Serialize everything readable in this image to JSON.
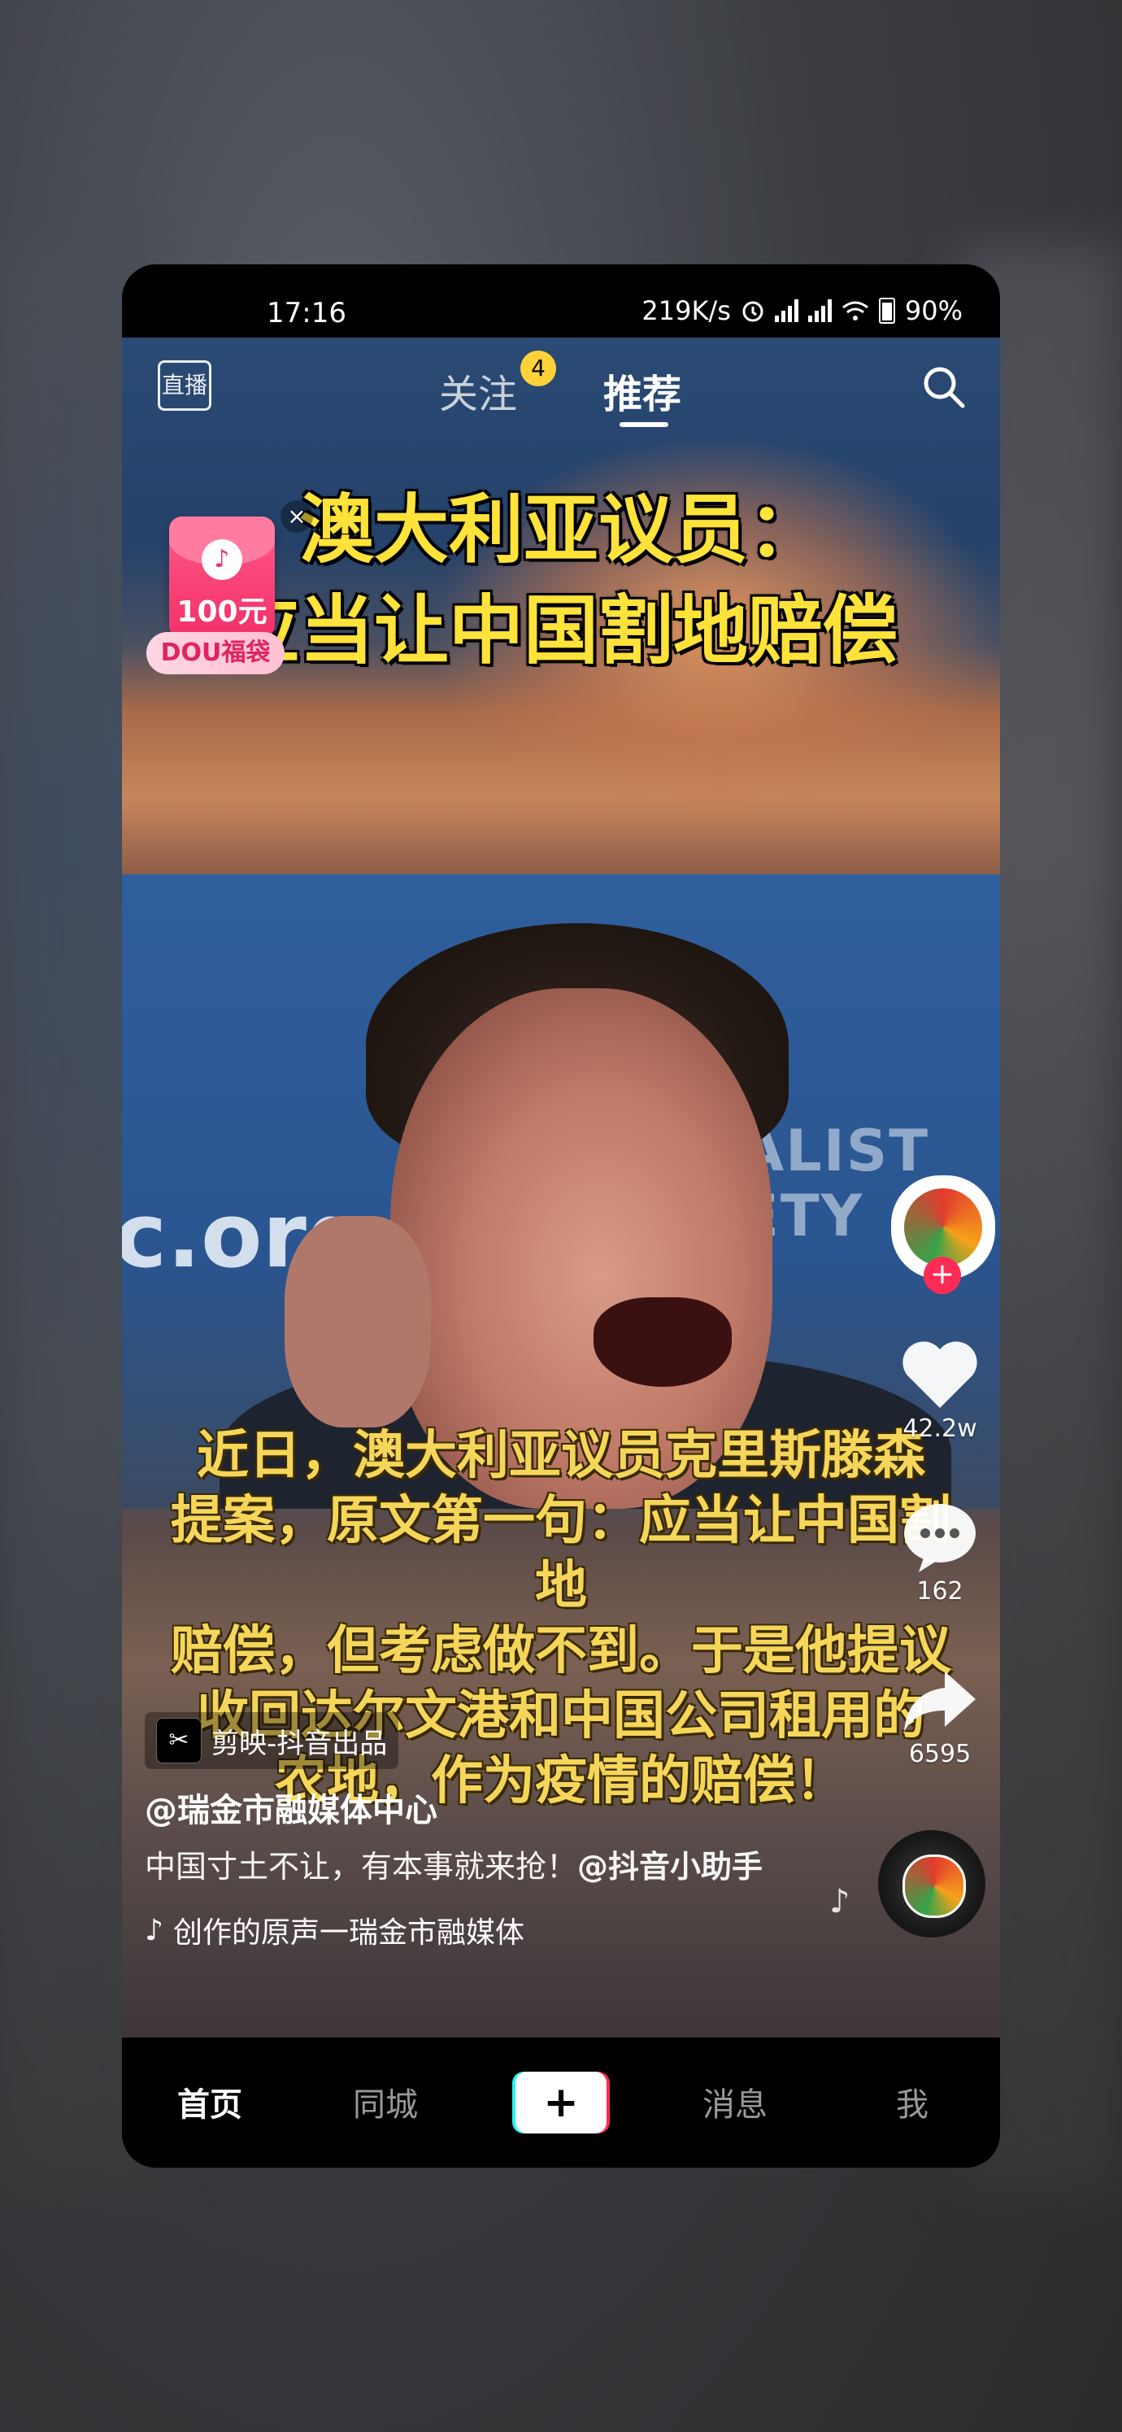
{
  "status_bar": {
    "time": "17:16",
    "net_speed": "219K/s",
    "battery": "90%"
  },
  "top_nav": {
    "live_label": "直播",
    "tabs": [
      {
        "label": "关注",
        "badge": "4"
      },
      {
        "label": "推荐"
      }
    ]
  },
  "red_packet": {
    "amount": "100元",
    "label": "DOU福袋",
    "close": "×"
  },
  "video": {
    "headline_line1": "澳大利亚议员：",
    "headline_line2": "应当让中国割地赔偿",
    "background_text_left": "c.org",
    "background_text_right": "ALIST\nETY",
    "subtitle_lines": [
      "近日，澳大利亚议员克里斯滕森",
      "提案，原文第一句：应当让中国割地",
      "赔偿，但考虑做不到。于是他提议",
      "收回达尔文港和中国公司租用的",
      "农地，作为疫情的赔偿！"
    ]
  },
  "right_rail": {
    "likes": "42.2w",
    "comments": "162",
    "shares": "6595"
  },
  "caption": {
    "capcut_label": "剪映-抖音出品",
    "author": "@瑞金市融媒体中心",
    "description": "中国寸土不让，有本事就来抢！",
    "mention": "@抖音小助手",
    "music": "创作的原声一瑞金市融媒体"
  },
  "bottom_nav": {
    "items": [
      "首页",
      "同城",
      "+",
      "消息",
      "我"
    ]
  }
}
